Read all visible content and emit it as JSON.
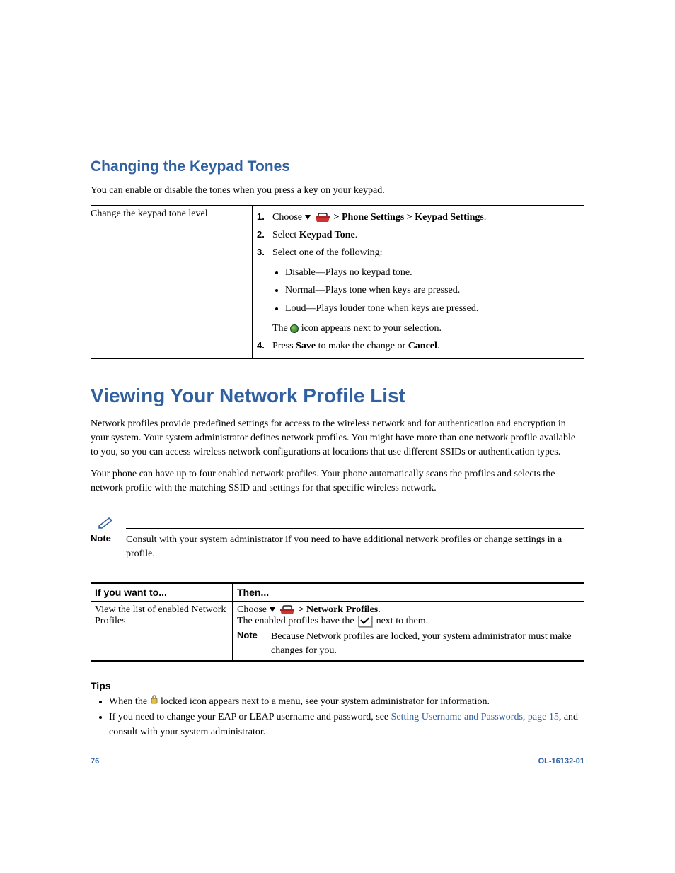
{
  "section1": {
    "heading": "Changing the Keypad Tones",
    "intro": "You can enable or disable the tones when you press a key on your keypad.",
    "row_label": "Change the keypad tone level",
    "steps": {
      "s1": {
        "num": "1.",
        "pre": "Choose ",
        "post": " > Phone Settings > Keypad Settings",
        "tail": "."
      },
      "s2": {
        "num": "2.",
        "pre": "Select ",
        "bold": "Keypad Tone",
        "tail": "."
      },
      "s3": {
        "num": "3.",
        "text": "Select one of the following:"
      },
      "bullets": {
        "b1": "Disable—Plays no keypad tone.",
        "b2": "Normal—Plays tone when keys are pressed.",
        "b3": "Loud—Plays louder tone when keys are pressed."
      },
      "selection_pre": "The ",
      "selection_post": " icon appears next to your selection.",
      "s4": {
        "num": "4.",
        "pre": "Press ",
        "b1": "Save",
        "mid": " to make the change or ",
        "b2": "Cancel",
        "tail": "."
      }
    }
  },
  "section2": {
    "heading": "Viewing Your Network Profile List",
    "p1": "Network profiles provide predefined settings for access to the wireless network and for authentication and encryption in your system. Your system administrator defines network profiles. You might have more than one network profile available to you, so you can access wireless network configurations at locations that use different SSIDs or authentication types.",
    "p2": "Your phone can have up to four enabled network profiles. Your phone automatically scans the profiles and selects the network profile with the matching SSID and settings for that specific wireless network.",
    "note_label": "Note",
    "note_body": "Consult with your system administrator if you need to have additional network profiles or change settings in a profile.",
    "table": {
      "h1": "If you want to...",
      "h2": "Then...",
      "r1c1": "View the list of enabled Network Profiles",
      "r1c2_line1_pre": "Choose ",
      "r1c2_line1_post": " > Network Profiles",
      "r1c2_line1_tail": ".",
      "r1c2_line2_pre": "The enabled profiles have the ",
      "r1c2_line2_post": " next to them.",
      "r1c2_note_label": "Note",
      "r1c2_note_body": "Because Network profiles are locked, your system administrator must make changes for you."
    },
    "tips_heading": "Tips",
    "tips": {
      "t1_pre": "When the ",
      "t1_post": " locked icon appears next to a menu, see your system administrator for information.",
      "t2_pre": "If you need to change your EAP or LEAP username and password, see ",
      "t2_link": "Setting Username and Passwords, page 15",
      "t2_post": ", and consult with your system administrator."
    }
  },
  "footer": {
    "page": "76",
    "docid": "OL-16132-01"
  }
}
